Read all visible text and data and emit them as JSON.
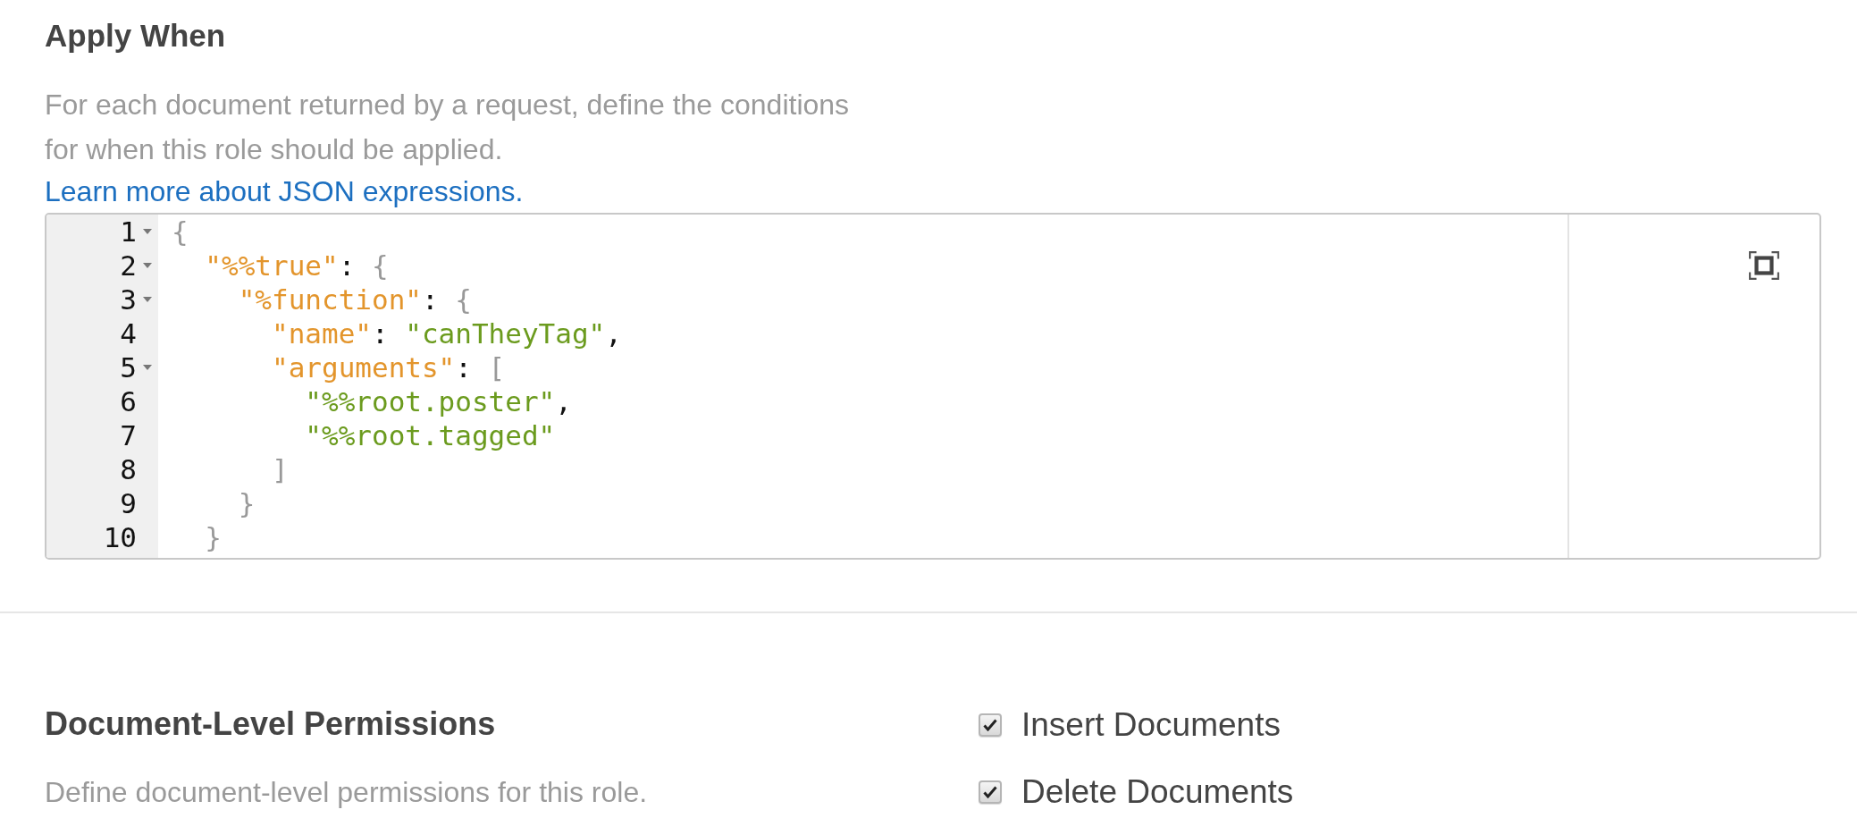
{
  "apply_when": {
    "title": "Apply When",
    "description": [
      "For each document returned by a request, define the conditions",
      "for when this role should be applied."
    ],
    "link": "Learn more about JSON expressions.",
    "editor": {
      "lines": [
        {
          "number": "1",
          "foldable": true,
          "tokens": [
            {
              "kind": "bracket",
              "text": "{"
            }
          ]
        },
        {
          "number": "2",
          "foldable": true,
          "tokens": [
            {
              "kind": "key",
              "text": "  \"%%true\""
            },
            {
              "kind": "punct",
              "text": ": "
            },
            {
              "kind": "bracket",
              "text": "{"
            }
          ]
        },
        {
          "number": "3",
          "foldable": true,
          "tokens": [
            {
              "kind": "key",
              "text": "    \"%function\""
            },
            {
              "kind": "punct",
              "text": ": "
            },
            {
              "kind": "bracket",
              "text": "{"
            }
          ]
        },
        {
          "number": "4",
          "foldable": false,
          "tokens": [
            {
              "kind": "key",
              "text": "      \"name\""
            },
            {
              "kind": "punct",
              "text": ": "
            },
            {
              "kind": "string",
              "text": "\"canTheyTag\""
            },
            {
              "kind": "punct",
              "text": ","
            }
          ]
        },
        {
          "number": "5",
          "foldable": true,
          "tokens": [
            {
              "kind": "key",
              "text": "      \"arguments\""
            },
            {
              "kind": "punct",
              "text": ": "
            },
            {
              "kind": "bracket",
              "text": "["
            }
          ]
        },
        {
          "number": "6",
          "foldable": false,
          "tokens": [
            {
              "kind": "string",
              "text": "        \"%%root.poster\""
            },
            {
              "kind": "punct",
              "text": ","
            }
          ]
        },
        {
          "number": "7",
          "foldable": false,
          "tokens": [
            {
              "kind": "string",
              "text": "        \"%%root.tagged\""
            }
          ]
        },
        {
          "number": "8",
          "foldable": false,
          "tokens": [
            {
              "kind": "bracket",
              "text": "      ]"
            }
          ]
        },
        {
          "number": "9",
          "foldable": false,
          "tokens": [
            {
              "kind": "bracket",
              "text": "    }"
            }
          ]
        },
        {
          "number": "10",
          "foldable": false,
          "tokens": [
            {
              "kind": "bracket",
              "text": "  }"
            }
          ]
        }
      ]
    }
  },
  "permissions": {
    "title": "Document-Level Permissions",
    "description": "Define document-level permissions for this role.",
    "options": [
      {
        "label": "Insert Documents",
        "checked": true
      },
      {
        "label": "Delete Documents",
        "checked": true
      }
    ]
  }
}
